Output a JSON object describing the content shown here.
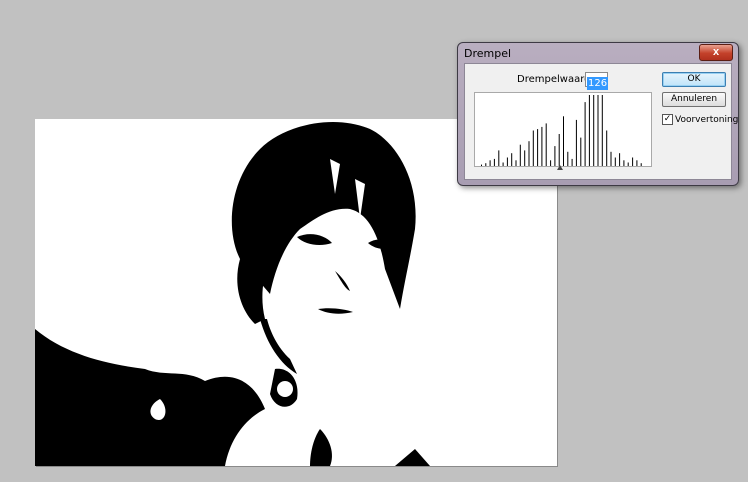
{
  "dialog": {
    "title": "Drempel",
    "close_glyph": "x",
    "threshold_label": "Drempelwaarde:",
    "threshold_value": "126",
    "ok_label": "OK",
    "cancel_label": "Annuleren",
    "preview_label": "Voorvertoning",
    "preview_checked": true,
    "preview_check_glyph": "✓"
  },
  "histogram": {
    "bar_heights_fraction": [
      0.02,
      0.04,
      0.08,
      0.1,
      0.22,
      0.05,
      0.12,
      0.18,
      0.08,
      0.3,
      0.22,
      0.35,
      0.5,
      0.52,
      0.55,
      0.6,
      0.08,
      0.28,
      0.45,
      0.7,
      0.2,
      0.1,
      0.65,
      0.4,
      0.9,
      1.0,
      1.0,
      1.0,
      1.0,
      0.5,
      0.2,
      0.12,
      0.18,
      0.08,
      0.05,
      0.12,
      0.08,
      0.04
    ]
  },
  "colors": {
    "workspace": "#c1c1c1",
    "selection_highlight": "#3399ff",
    "ok_border": "#3c7fb1"
  }
}
